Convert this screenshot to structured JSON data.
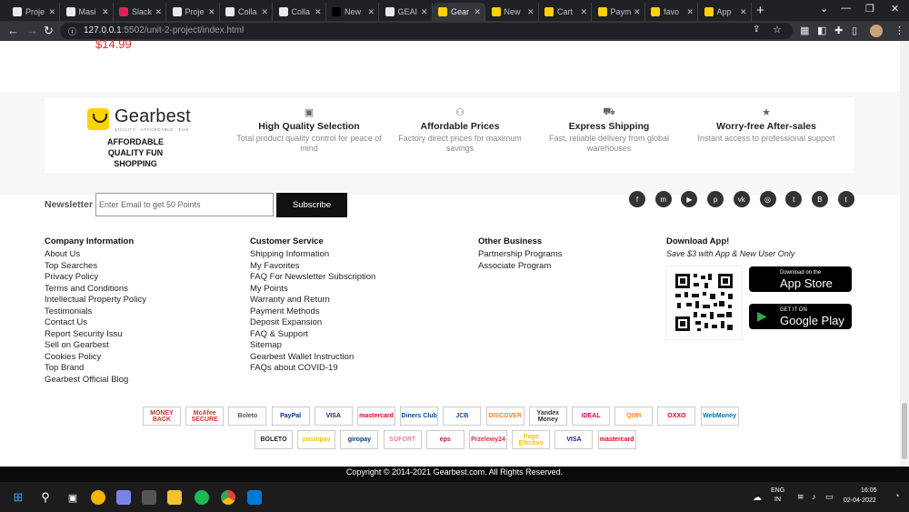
{
  "tabs": [
    {
      "label": "Proje",
      "color": "#e8eaed"
    },
    {
      "label": "Masi",
      "color": "#e8eaed"
    },
    {
      "label": "Slack",
      "color": "#e01e5a"
    },
    {
      "label": "Proje",
      "color": "#e8eaed"
    },
    {
      "label": "Colla",
      "color": "#e8eaed"
    },
    {
      "label": "Colla",
      "color": "#e8eaed"
    },
    {
      "label": "New",
      "color": "#000000"
    },
    {
      "label": "GEAI",
      "color": "#e8eaed"
    },
    {
      "label": "Gear",
      "color": "#ffd200"
    },
    {
      "label": "New",
      "color": "#ffd200"
    },
    {
      "label": "Cart",
      "color": "#ffd200"
    },
    {
      "label": "Paym",
      "color": "#ffd200"
    },
    {
      "label": "favo",
      "color": "#ffd200"
    },
    {
      "label": "App",
      "color": "#ffd200"
    }
  ],
  "toolbar": {
    "url_host": "127.0.0.1",
    "url_rest": ":5502/unit-2-project/index.html"
  },
  "page": {
    "price": "$14.99",
    "brand": {
      "name": "Gearbest",
      "tagline": "QUALITY · AFFORDABLE · FUN",
      "slogan": "AFFORDABLE QUALITY FUN SHOPPING"
    },
    "features": [
      {
        "icon": "gift-box-icon",
        "title": "High Quality Selection",
        "desc": "Total product quality control for peace of mind"
      },
      {
        "icon": "coin-hand-icon",
        "title": "Affordable Prices",
        "desc": "Factory direct prices for maximum savings"
      },
      {
        "icon": "truck-icon",
        "title": "Express Shipping",
        "desc": "Fast, reliable delivery from global warehouses"
      },
      {
        "icon": "star-icon",
        "title": "Worry-free After-sales",
        "desc": "Instant access to professional support"
      }
    ],
    "newsletter": {
      "label": "Newsletter",
      "placeholder": "Enter Email to get 50 Points",
      "button": "Subscribe"
    },
    "social": [
      {
        "name": "facebook-icon",
        "glyph": "f"
      },
      {
        "name": "messenger-icon",
        "glyph": "m"
      },
      {
        "name": "youtube-icon",
        "glyph": "▶"
      },
      {
        "name": "pinterest-icon",
        "glyph": "p"
      },
      {
        "name": "vk-icon",
        "glyph": "vk"
      },
      {
        "name": "instagram-icon",
        "glyph": "◎"
      },
      {
        "name": "twitter-icon",
        "glyph": "t"
      },
      {
        "name": "blogger-icon",
        "glyph": "B"
      },
      {
        "name": "tumblr-icon",
        "glyph": "t"
      }
    ],
    "columns": [
      {
        "title": "Company Information",
        "links": [
          "About Us",
          "Top Searches",
          "Privacy Policy",
          "Terms and Conditions",
          "Intellectual Property Policy",
          "Testimonials",
          "Contact Us",
          "Report Security Issu",
          "Sell on Gearbest",
          "Cookies Policy",
          "Top Brand",
          "Gearbest Official Blog"
        ]
      },
      {
        "title": "Customer Service",
        "links": [
          "Shipping Information",
          "My Favorites",
          "FAQ For Newsletter Subscription",
          "My Points",
          "Warranty and Return",
          "Payment Methods",
          "Deposit Expansion",
          "FAQ & Support",
          "Sitemap",
          "Gearbest Wallet Instruction",
          "FAQs about COVID-19"
        ]
      },
      {
        "title": "Other Business",
        "links": [
          "Partnership Programs",
          "Associate Program"
        ]
      }
    ],
    "download": {
      "title": "Download App!",
      "subtitle": "Save $3 with App & New User Only",
      "appstore_small": "Download on the",
      "appstore_big": "App Store",
      "google_small": "GET IT ON",
      "google_big": "Google Play"
    },
    "payments_row1": [
      {
        "label": "MONEY BACK",
        "color": "#c0392b"
      },
      {
        "label": "McAfee SECURE",
        "color": "#c0392b"
      },
      {
        "label": "Boleto",
        "color": "#555555"
      },
      {
        "label": "PayPal",
        "color": "#003087"
      },
      {
        "label": "VISA",
        "color": "#1a1f71"
      },
      {
        "label": "mastercard",
        "color": "#eb001b"
      },
      {
        "label": "Diners Club",
        "color": "#004a97"
      },
      {
        "label": "JCB",
        "color": "#0e4c96"
      },
      {
        "label": "DISCOVER",
        "color": "#f48120"
      },
      {
        "label": "Yandex Money",
        "color": "#333333"
      },
      {
        "label": "iDEAL",
        "color": "#cc0066"
      },
      {
        "label": "QIWI",
        "color": "#ff8c00"
      },
      {
        "label": "OXXO",
        "color": "#e2001a"
      },
      {
        "label": "WebMoney",
        "color": "#036cb5"
      }
    ],
    "payments_row2": [
      {
        "label": "BOLETO",
        "color": "#222222"
      },
      {
        "label": "postepay",
        "color": "#f5c400"
      },
      {
        "label": "giropay",
        "color": "#003a7d"
      },
      {
        "label": "SOFORT",
        "color": "#ef809f"
      },
      {
        "label": "eps",
        "color": "#c8102e"
      },
      {
        "label": "Przelewy24",
        "color": "#d13239"
      },
      {
        "label": "Pago Efectivo",
        "color": "#f2c500"
      },
      {
        "label": "VISA",
        "color": "#1a1f71"
      },
      {
        "label": "mastercard",
        "color": "#eb001b"
      }
    ],
    "copyright": "Copyright © 2014-2021 Gearbest.com. All Rights Reserved."
  },
  "taskbar": {
    "lang1": "ENG",
    "lang2": "IN",
    "time": "16:05",
    "date": "02-04-2022"
  }
}
